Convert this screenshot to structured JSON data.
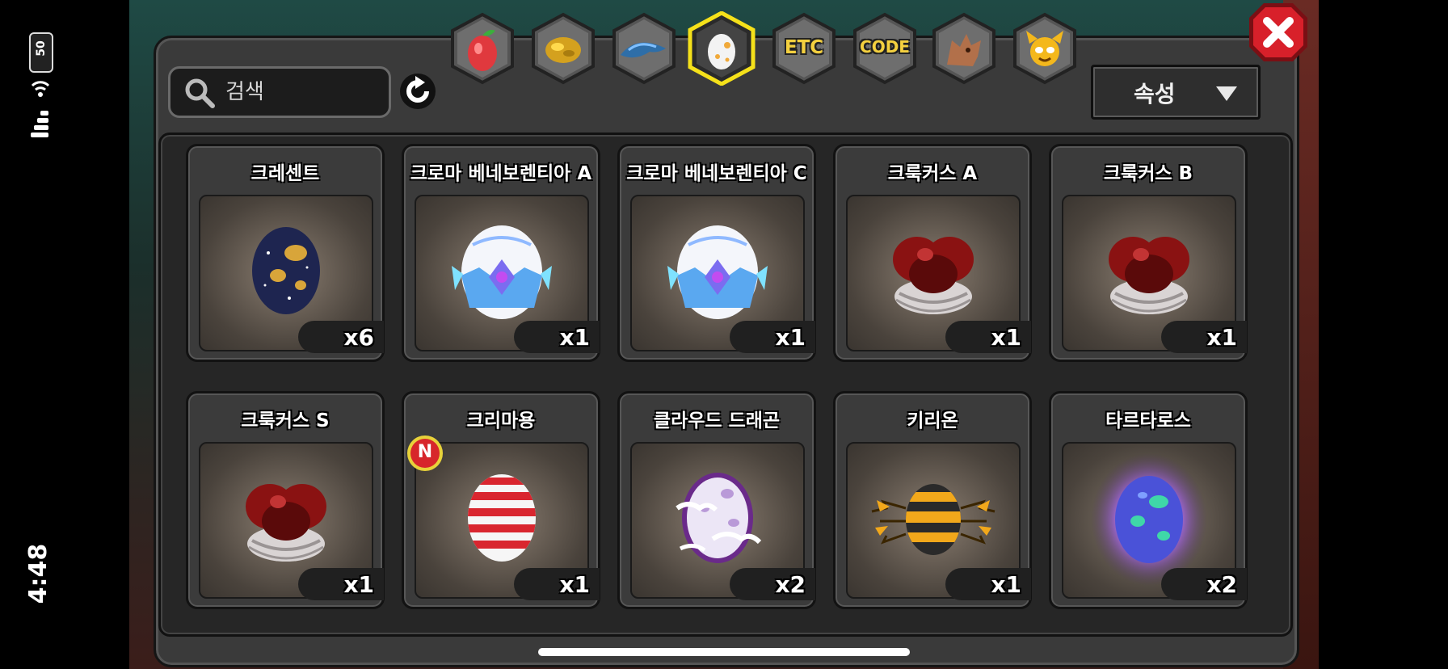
{
  "status_bar": {
    "time": "4:48",
    "battery": "50"
  },
  "search": {
    "placeholder": "검색"
  },
  "tabs": [
    {
      "icon": "fruit-icon",
      "label": ""
    },
    {
      "icon": "gold-ore-icon",
      "label": ""
    },
    {
      "icon": "blue-dragon-icon",
      "label": ""
    },
    {
      "icon": "egg-icon",
      "label": "",
      "active": true
    },
    {
      "icon": "etc-icon",
      "label": "ETC"
    },
    {
      "icon": "code-icon",
      "label": "CODE"
    },
    {
      "icon": "dragon-head-icon",
      "label": ""
    },
    {
      "icon": "yellow-monster-icon",
      "label": ""
    }
  ],
  "sort": {
    "label": "속성"
  },
  "items": [
    {
      "name": "크레센트",
      "qty": "x6",
      "egg": "crescent-egg-icon",
      "new": false
    },
    {
      "name": "크로마 베네보렌티아 A",
      "qty": "x1",
      "egg": "chroma-egg-icon",
      "new": false
    },
    {
      "name": "크로마 베네보렌티아 C",
      "qty": "x1",
      "egg": "chroma-egg-icon",
      "new": false
    },
    {
      "name": "크룩커스 A",
      "qty": "x1",
      "egg": "crookus-egg-icon",
      "new": false
    },
    {
      "name": "크룩커스 B",
      "qty": "x1",
      "egg": "crookus-egg-icon",
      "new": false
    },
    {
      "name": "크룩커스 S",
      "qty": "x1",
      "egg": "crookus-egg-icon",
      "new": false
    },
    {
      "name": "크리마용",
      "qty": "x1",
      "egg": "striped-egg-icon",
      "new": true,
      "new_label": "N"
    },
    {
      "name": "클라우드 드래곤",
      "qty": "x2",
      "egg": "cloud-egg-icon",
      "new": false
    },
    {
      "name": "키리온",
      "qty": "x1",
      "egg": "bee-egg-icon",
      "new": false
    },
    {
      "name": "타르타로스",
      "qty": "x2",
      "egg": "purple-glow-egg-icon",
      "new": false
    }
  ],
  "colors": {
    "active_tab_border": "#f5e11a",
    "close_red": "#d8202a",
    "tab_text": "#f4d03f"
  }
}
